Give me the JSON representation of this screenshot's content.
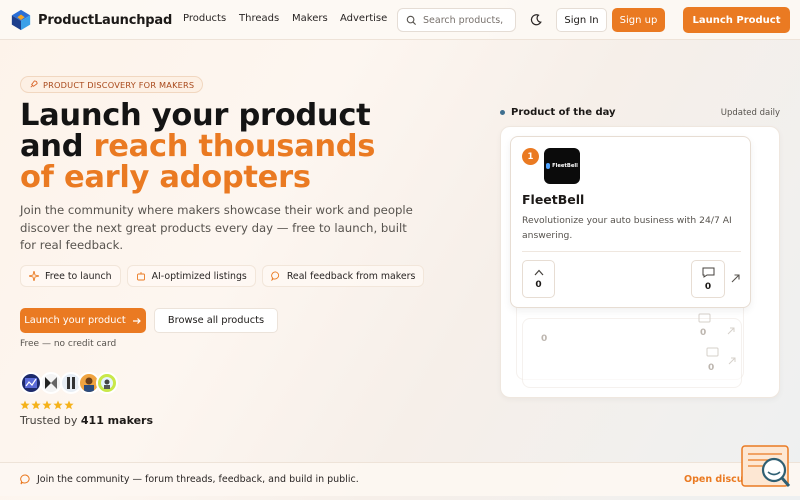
{
  "header": {
    "brand": "ProductLaunchpad",
    "nav": [
      "Products",
      "Threads",
      "Makers",
      "Advertise"
    ],
    "search_placeholder": "Search products,",
    "sign_in": "Sign In",
    "sign_up": "Sign up",
    "launch": "Launch Product"
  },
  "hero": {
    "badge": "PRODUCT DISCOVERY FOR MAKERS",
    "title_line1": "Launch your product",
    "title_and": "and ",
    "title_accent1": "reach thousands",
    "title_accent2": "of early adopters",
    "subtitle": "Join the community where makers showcase their work and people discover the next great products every day — free to launch, built for real feedback.",
    "features": [
      "Free to launch",
      "AI-optimized listings",
      "Real feedback from makers"
    ],
    "cta_primary": "Launch your product",
    "cta_secondary": "Browse all products",
    "free_note": "Free — no credit card",
    "stars": 5,
    "trusted_prefix": "Trusted by ",
    "trusted_count": "411 makers"
  },
  "product_of_day": {
    "label": "Product of the day",
    "updated": "Updated daily",
    "rank": "1",
    "logo_text": "FleetBell",
    "name": "FleetBell",
    "description": "Revolutionize your auto business with 24/7 AI answering.",
    "upvotes": "0",
    "comments": "0",
    "ghost_counts": [
      "0",
      "0",
      "0"
    ]
  },
  "footer": {
    "text": "Join the community — forum threads, feedback, and build in public.",
    "link": "Open discussions"
  },
  "colors": {
    "accent": "#ea7a22",
    "text": "#1c1917"
  }
}
